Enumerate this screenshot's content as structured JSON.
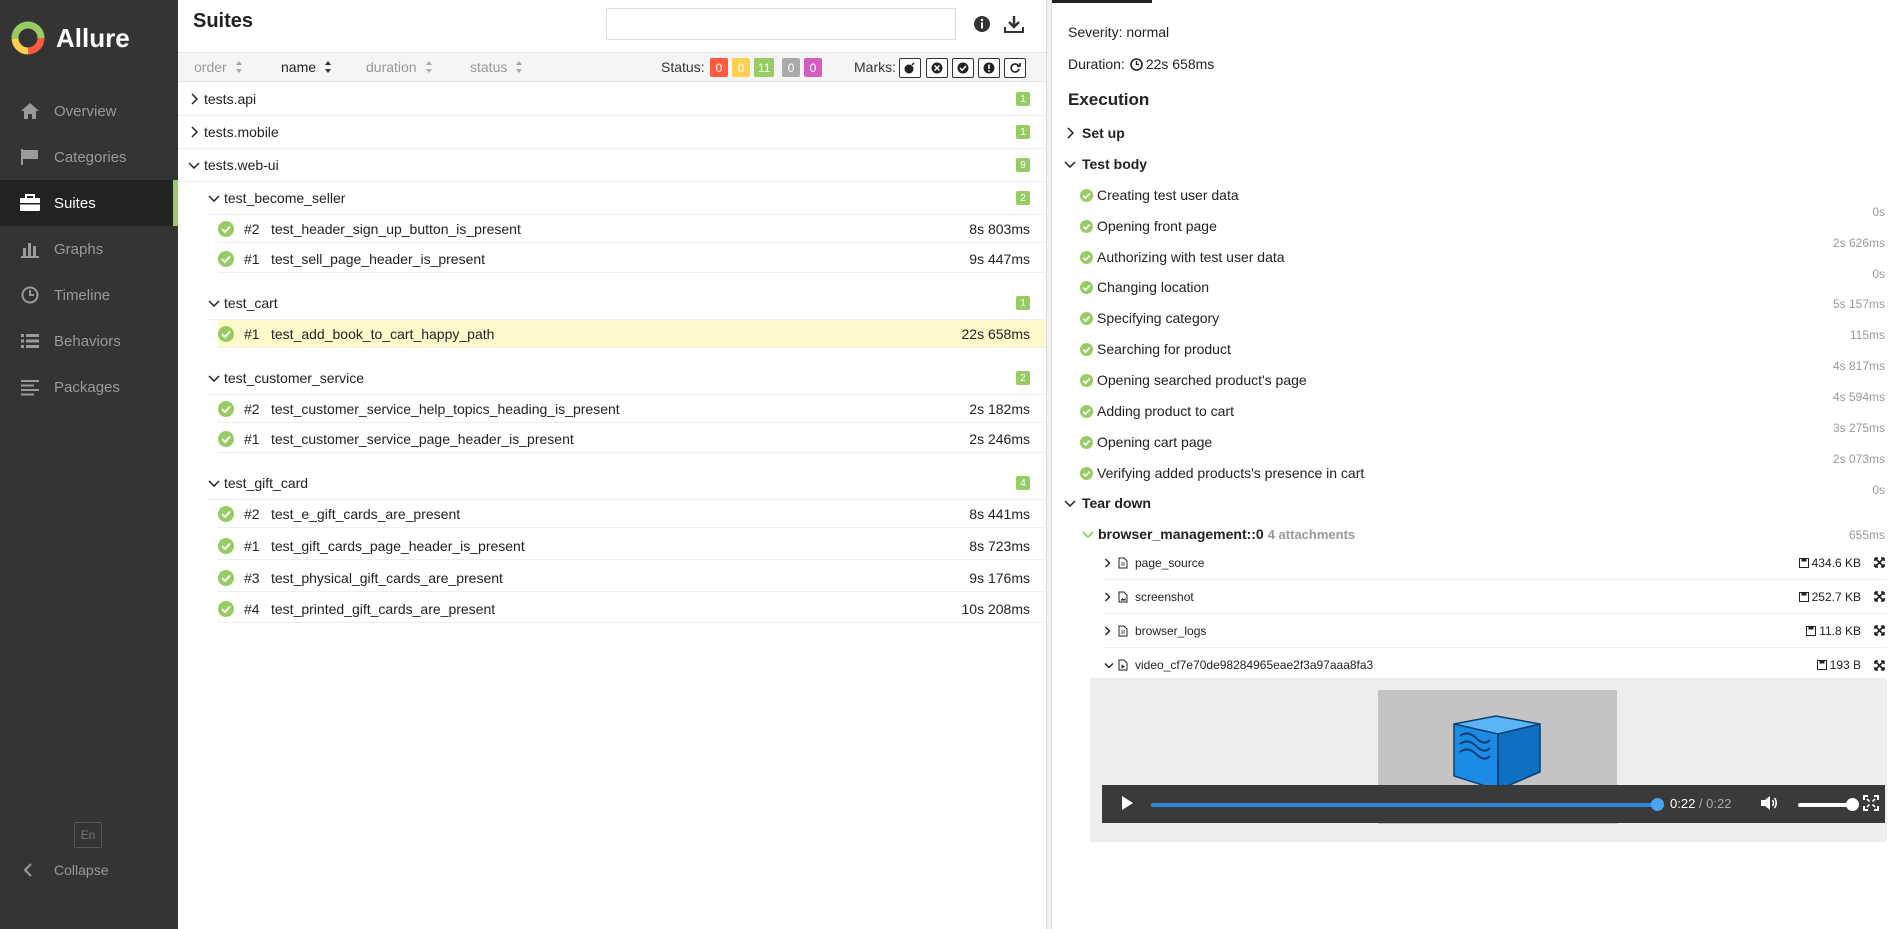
{
  "app": {
    "name": "Allure"
  },
  "sidebar": {
    "items": [
      {
        "label": "Overview",
        "icon": "home-icon"
      },
      {
        "label": "Categories",
        "icon": "flag-icon"
      },
      {
        "label": "Suites",
        "icon": "briefcase-icon",
        "active": true
      },
      {
        "label": "Graphs",
        "icon": "bar-chart-icon"
      },
      {
        "label": "Timeline",
        "icon": "clock-icon"
      },
      {
        "label": "Behaviors",
        "icon": "list-icon"
      },
      {
        "label": "Packages",
        "icon": "align-left-icon"
      }
    ],
    "language": "En",
    "collapse_label": "Collapse"
  },
  "suites": {
    "title": "Suites",
    "search_placeholder": "",
    "sort": {
      "order": "order",
      "name": "name",
      "duration": "duration",
      "status": "status"
    },
    "status_label": "Status:",
    "status_counts": [
      {
        "value": "0",
        "color": "#fd5a3e"
      },
      {
        "value": "0",
        "color": "#ffd050"
      },
      {
        "value": "11",
        "color": "#97cc64"
      },
      {
        "value": "0",
        "color": "#aaaaaa"
      },
      {
        "value": "0",
        "color": "#d35ebe"
      }
    ],
    "marks_label": "Marks:",
    "groups": [
      {
        "name": "tests.api",
        "count": "1"
      },
      {
        "name": "tests.mobile",
        "count": "1"
      },
      {
        "name": "tests.web-ui",
        "count": "9"
      }
    ],
    "subgroups": [
      {
        "name": "test_become_seller",
        "count": "2",
        "tests": [
          {
            "num": "#2",
            "name": "test_header_sign_up_button_is_present",
            "duration": "8s 803ms"
          },
          {
            "num": "#1",
            "name": "test_sell_page_header_is_present",
            "duration": "9s 447ms"
          }
        ]
      },
      {
        "name": "test_cart",
        "count": "1",
        "tests": [
          {
            "num": "#1",
            "name": "test_add_book_to_cart_happy_path",
            "duration": "22s 658ms"
          }
        ]
      },
      {
        "name": "test_customer_service",
        "count": "2",
        "tests": [
          {
            "num": "#2",
            "name": "test_customer_service_help_topics_heading_is_present",
            "duration": "2s 182ms"
          },
          {
            "num": "#1",
            "name": "test_customer_service_page_header_is_present",
            "duration": "2s 246ms"
          }
        ]
      },
      {
        "name": "test_gift_card",
        "count": "4",
        "tests": [
          {
            "num": "#2",
            "name": "test_e_gift_cards_are_present",
            "duration": "8s 441ms"
          },
          {
            "num": "#1",
            "name": "test_gift_cards_page_header_is_present",
            "duration": "8s 723ms"
          },
          {
            "num": "#3",
            "name": "test_physical_gift_cards_are_present",
            "duration": "9s 176ms"
          },
          {
            "num": "#4",
            "name": "test_printed_gift_cards_are_present",
            "duration": "10s 208ms"
          }
        ]
      }
    ]
  },
  "details": {
    "severity": "Severity: normal",
    "duration_label": "Duration:",
    "duration_value": "22s 658ms",
    "execution_title": "Execution",
    "setup_label": "Set up",
    "body_label": "Test body",
    "steps": [
      {
        "name": "Creating test user data",
        "duration": "0s"
      },
      {
        "name": "Opening front page",
        "duration": "2s 626ms"
      },
      {
        "name": "Authorizing with test user data",
        "duration": "0s"
      },
      {
        "name": "Changing location",
        "duration": "5s 157ms"
      },
      {
        "name": "Specifying category",
        "duration": "115ms"
      },
      {
        "name": "Searching for product",
        "duration": "4s 817ms"
      },
      {
        "name": "Opening searched product's page",
        "duration": "4s 594ms"
      },
      {
        "name": "Adding product to cart",
        "duration": "3s 275ms"
      },
      {
        "name": "Opening cart page",
        "duration": "2s 073ms"
      },
      {
        "name": "Verifying added products's presence in cart",
        "duration": "0s"
      }
    ],
    "teardown_label": "Tear down",
    "fixture_name": "browser_management::0",
    "fixture_attachments": "4 attachments",
    "fixture_duration": "655ms",
    "attachments": [
      {
        "name": "page_source",
        "size": "434.6 KB",
        "expanded": false
      },
      {
        "name": "screenshot",
        "size": "252.7 KB",
        "expanded": false
      },
      {
        "name": "browser_logs",
        "size": "11.8 KB",
        "expanded": false
      },
      {
        "name": "video_cf7e70de98284965eae2f3a97aaa8fa3",
        "size": "193 B",
        "expanded": true
      }
    ],
    "video": {
      "current": "0:22",
      "sep": " / ",
      "total": "0:22",
      "progress": 1.0,
      "volume": 1.0
    }
  }
}
